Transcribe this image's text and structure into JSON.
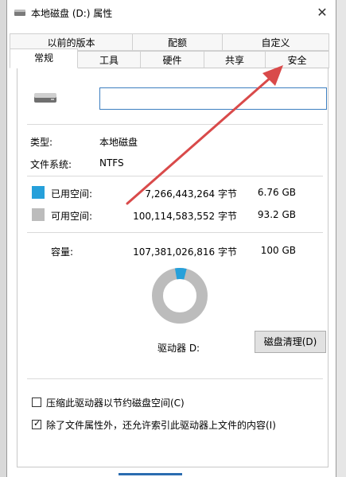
{
  "window": {
    "title": "本地磁盘 (D:) 属性",
    "close_glyph": "✕"
  },
  "tabs_top": [
    "以前的版本",
    "配额",
    "自定义"
  ],
  "tabs_bottom": [
    "常规",
    "工具",
    "硬件",
    "共享",
    "安全"
  ],
  "active_tab": "常规",
  "general": {
    "name_value": "",
    "type_label": "类型:",
    "type_value": "本地磁盘",
    "fs_label": "文件系统:",
    "fs_value": "NTFS",
    "used": {
      "label": "已用空间:",
      "bytes": "7,266,443,264 字节",
      "size": "6.76 GB",
      "color": "#26a0da"
    },
    "free": {
      "label": "可用空间:",
      "bytes": "100,114,583,552 字节",
      "size": "93.2 GB",
      "color": "#bcbcbc"
    },
    "capacity": {
      "label": "容量:",
      "bytes": "107,381,026,816 字节",
      "size": "100 GB"
    },
    "used_fraction": 0.0677,
    "drive_label": "驱动器 D:",
    "clean_button": "磁盘清理(D)",
    "compress_label": "压缩此驱动器以节约磁盘空间(C)",
    "compress_checked": false,
    "index_label": "除了文件属性外，还允许索引此驱动器上文件的内容(I)",
    "index_checked": true
  },
  "colors": {
    "accent": "#26a0da",
    "arrow": "#d94a4a",
    "input_border": "#3d7fc0"
  }
}
